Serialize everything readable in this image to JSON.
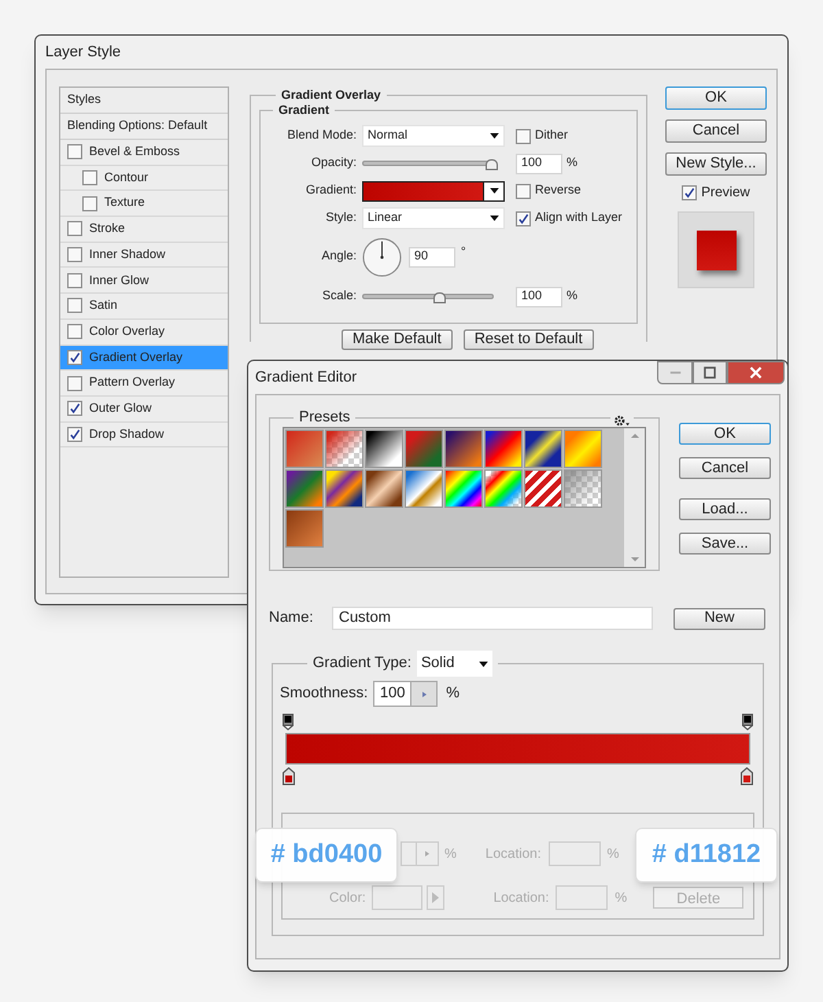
{
  "layer_style": {
    "title": "Layer Style",
    "styles_header": "Styles",
    "blending_options": "Blending Options: Default",
    "effects": [
      {
        "label": "Bevel & Emboss",
        "checked": false,
        "selected": false,
        "children": [
          {
            "label": "Contour",
            "checked": false,
            "selected": false
          },
          {
            "label": "Texture",
            "checked": false,
            "selected": false
          }
        ]
      },
      {
        "label": "Stroke",
        "checked": false,
        "selected": false
      },
      {
        "label": "Inner Shadow",
        "checked": false,
        "selected": false
      },
      {
        "label": "Inner Glow",
        "checked": false,
        "selected": false
      },
      {
        "label": "Satin",
        "checked": false,
        "selected": false
      },
      {
        "label": "Color Overlay",
        "checked": false,
        "selected": false
      },
      {
        "label": "Gradient Overlay",
        "checked": true,
        "selected": true
      },
      {
        "label": "Pattern Overlay",
        "checked": false,
        "selected": false
      },
      {
        "label": "Outer Glow",
        "checked": true,
        "selected": false
      },
      {
        "label": "Drop Shadow",
        "checked": true,
        "selected": false
      }
    ],
    "section_title": "Gradient Overlay",
    "group_title": "Gradient",
    "blend_mode": {
      "label": "Blend Mode:",
      "value": "Normal"
    },
    "dither": {
      "label": "Dither",
      "checked": false
    },
    "opacity": {
      "label": "Opacity:",
      "level": 1.0,
      "value": "100",
      "unit": "%"
    },
    "gradient": {
      "label": "Gradient:"
    },
    "reverse": {
      "label": "Reverse",
      "checked": false
    },
    "style": {
      "label": "Style:",
      "value": "Linear"
    },
    "align": {
      "label": "Align with Layer",
      "checked": true
    },
    "angle": {
      "label": "Angle:",
      "value": "90",
      "unit": "°"
    },
    "scale": {
      "label": "Scale:",
      "level": 0.6,
      "value": "100",
      "unit": "%"
    },
    "buttons": [
      "Make Default",
      "Reset to Default"
    ],
    "side_buttons": [
      {
        "label": "OK",
        "default": true
      },
      {
        "label": "Cancel",
        "default": false
      },
      {
        "label": "New Style...",
        "default": false
      }
    ],
    "preview": {
      "label": "Preview",
      "checked": true
    }
  },
  "gradient_editor": {
    "title": "Gradient Editor",
    "presets_label": "Presets",
    "side_buttons": [
      {
        "label": "OK",
        "default": true
      },
      {
        "label": "Cancel",
        "default": false
      },
      {
        "label": "Load...",
        "default": false
      },
      {
        "label": "Save...",
        "default": false
      }
    ],
    "name": {
      "label": "Name:",
      "value": "Custom"
    },
    "new_button": "New",
    "gradient_type": {
      "label": "Gradient Type:",
      "value": "Solid"
    },
    "smoothness": {
      "label": "Smoothness:",
      "value": "100",
      "unit": "%"
    },
    "stops": [
      {
        "color": "#bd0400"
      },
      {
        "color": "#d11812"
      }
    ],
    "stop_row_1": {
      "unit": "%",
      "location_label": "Location:",
      "location_unit": "%"
    },
    "stop_row_2": {
      "color_label": "Color:",
      "location_label": "Location:",
      "location_unit": "%",
      "delete_button": "Delete"
    },
    "callouts": [
      "# bd0400",
      "# d11812"
    ]
  }
}
